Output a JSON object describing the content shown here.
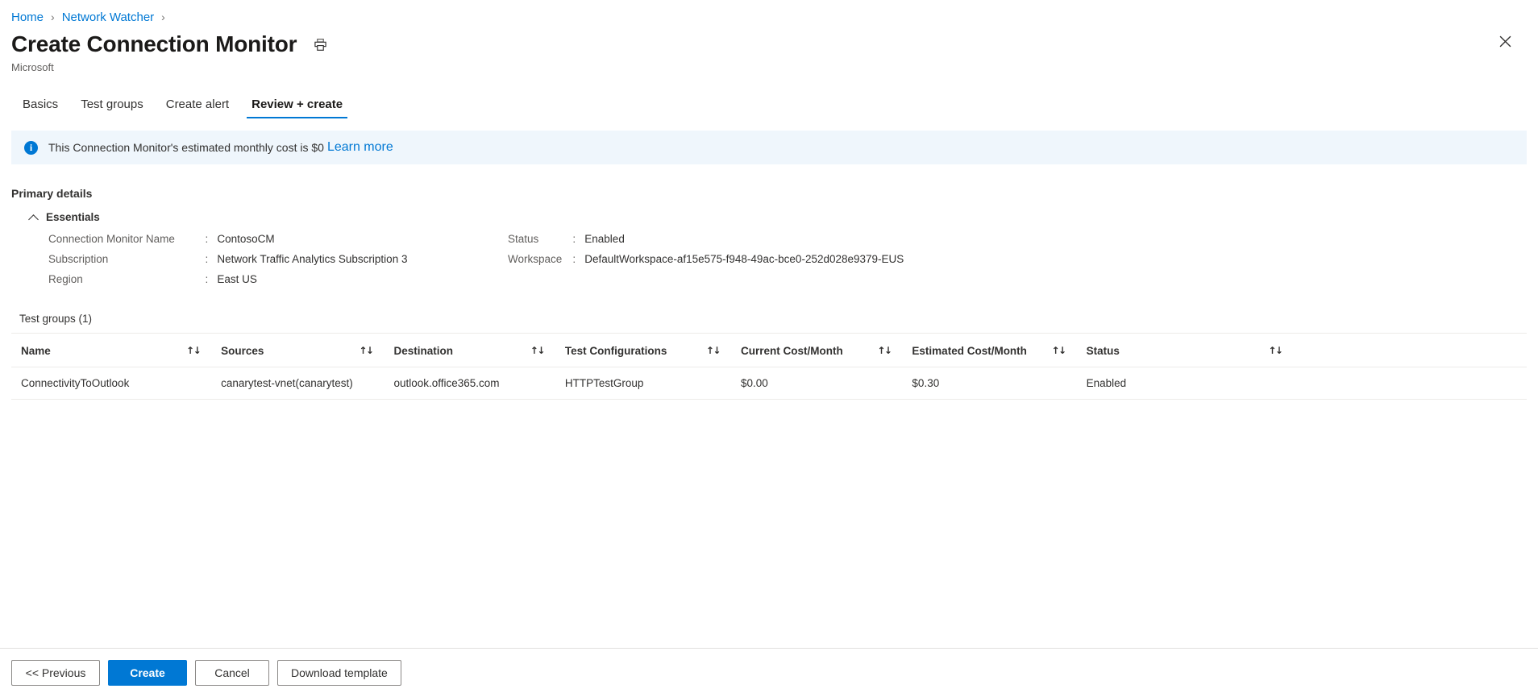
{
  "breadcrumb": {
    "items": [
      {
        "label": "Home"
      },
      {
        "label": "Network Watcher"
      }
    ],
    "separator": "›"
  },
  "header": {
    "title": "Create Connection Monitor",
    "subtitle": "Microsoft",
    "print_icon": "printer-icon",
    "close_icon": "close-icon",
    "close_glyph": "✕"
  },
  "tabs": [
    {
      "label": "Basics",
      "active": false
    },
    {
      "label": "Test groups",
      "active": false
    },
    {
      "label": "Create alert",
      "active": false
    },
    {
      "label": "Review + create",
      "active": true
    }
  ],
  "info_banner": {
    "icon": "info-icon",
    "icon_glyph": "i",
    "text": "This Connection Monitor's estimated monthly cost is $0",
    "link_label": "Learn more"
  },
  "primary_details": {
    "section_title": "Primary details",
    "essentials_label": "Essentials",
    "essentials_expanded": true,
    "left": [
      {
        "key": "Connection Monitor Name",
        "colon": ":",
        "value": "ContosoCM"
      },
      {
        "key": "Subscription",
        "colon": ":",
        "value": "Network Traffic Analytics Subscription 3"
      },
      {
        "key": "Region",
        "colon": ":",
        "value": "East US"
      }
    ],
    "right": [
      {
        "key": "Status",
        "colon": ":",
        "value": "Enabled"
      },
      {
        "key": "Workspace",
        "colon": ":",
        "value": "DefaultWorkspace-af15e575-f948-49ac-bce0-252d028e9379-EUS"
      }
    ]
  },
  "test_groups": {
    "title": "Test groups (1)",
    "sort_glyph": "↑↓",
    "columns": [
      "Name",
      "Sources",
      "Destination",
      "Test Configurations",
      "Current Cost/Month",
      "Estimated Cost/Month",
      "Status"
    ],
    "rows": [
      {
        "name": "ConnectivityToOutlook",
        "sources": "canarytest-vnet(canarytest)",
        "destination": "outlook.office365.com",
        "test_configurations": "HTTPTestGroup",
        "current_cost": "$0.00",
        "estimated_cost": "$0.30",
        "status": "Enabled"
      }
    ]
  },
  "footer": {
    "previous_label": "<< Previous",
    "create_label": "Create",
    "cancel_label": "Cancel",
    "download_label": "Download template"
  },
  "colors": {
    "accent": "#0078d4",
    "link": "#0078d4",
    "banner_bg": "#eff6fc",
    "border": "#edebe9",
    "text": "#323130",
    "muted": "#605e5c"
  }
}
